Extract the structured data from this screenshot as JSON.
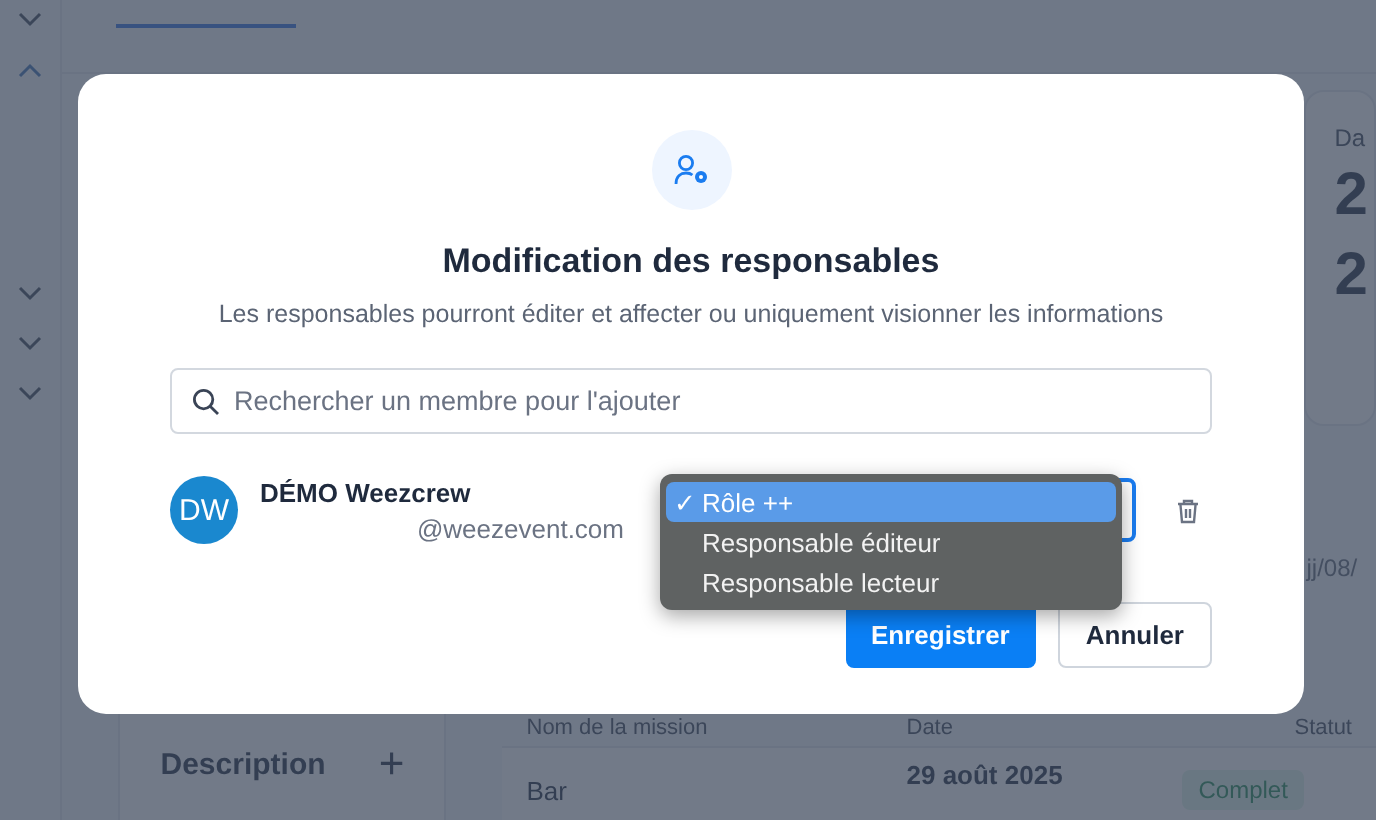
{
  "background": {
    "card": {
      "label": "Da",
      "values": [
        "2",
        "2"
      ]
    },
    "date_field": {
      "value": "jj/08/"
    },
    "side_panel": {
      "title": "Description",
      "add_icon": "+"
    },
    "table": {
      "columns": [
        "Nom de la mission",
        "Date",
        "Statut"
      ],
      "rows": [
        {
          "name": "Bar",
          "date": "29 août 2025",
          "status": "Complet"
        }
      ]
    }
  },
  "dialog": {
    "title": "Modification des responsables",
    "subtitle": "Les responsables pourront éditer et affecter ou uniquement visionner les informations",
    "search": {
      "placeholder": "Rechercher un membre pour l'ajouter"
    },
    "members": [
      {
        "initials": "DW",
        "name": "DÉMO Weezcrew",
        "email": "@weezevent.com"
      }
    ],
    "role_menu_check": "✓",
    "role_menu": [
      {
        "label": "Rôle ++",
        "selected": true
      },
      {
        "label": "Responsable éditeur",
        "selected": false
      },
      {
        "label": "Responsable lecteur",
        "selected": false
      }
    ],
    "buttons": [
      {
        "label": "Enregistrer",
        "kind": "primary"
      },
      {
        "label": "Annuler",
        "kind": "secondary"
      }
    ]
  }
}
